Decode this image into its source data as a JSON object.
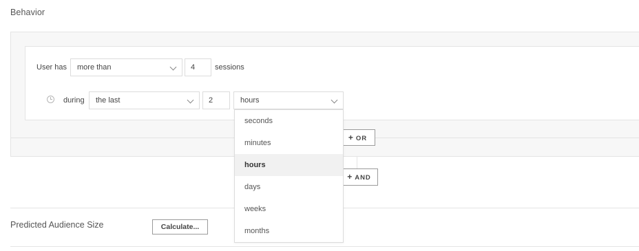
{
  "section": {
    "title": "Behavior"
  },
  "rule": {
    "prefix": "User has",
    "comparator": "more than",
    "count": "4",
    "unit_label": "sessions",
    "time_prefix": "during",
    "time_qualifier": "the last",
    "time_value": "2",
    "time_unit": "hours"
  },
  "dropdown": {
    "options": [
      "seconds",
      "minutes",
      "hours",
      "days",
      "weeks",
      "months"
    ],
    "selected": "hours"
  },
  "buttons": {
    "or_label": "OR",
    "and_label": "AND",
    "plus_symbol": "+",
    "calculate_label": "Calculate..."
  },
  "footer": {
    "predicted_label": "Predicted Audience Size"
  },
  "icons": {
    "time": "clock-icon",
    "chevron": "chevron-down-icon"
  }
}
